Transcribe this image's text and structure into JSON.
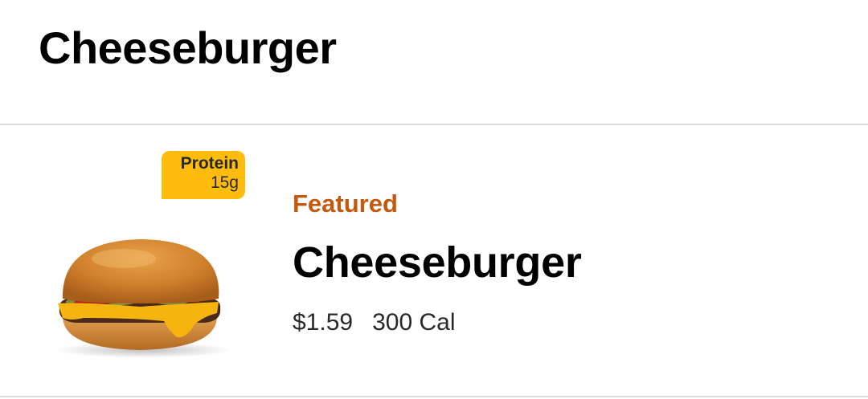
{
  "header": {
    "title": "Cheeseburger"
  },
  "menu_item": {
    "badge": {
      "label": "Protein",
      "value": "15g"
    },
    "tag": "Featured",
    "name": "Cheeseburger",
    "price": "$1.59",
    "calories": "300 Cal",
    "image_icon": "cheeseburger-image"
  },
  "colors": {
    "badge_background": "#FFBC0D",
    "featured_text": "#C4580C",
    "divider": "#DCDCDC"
  }
}
